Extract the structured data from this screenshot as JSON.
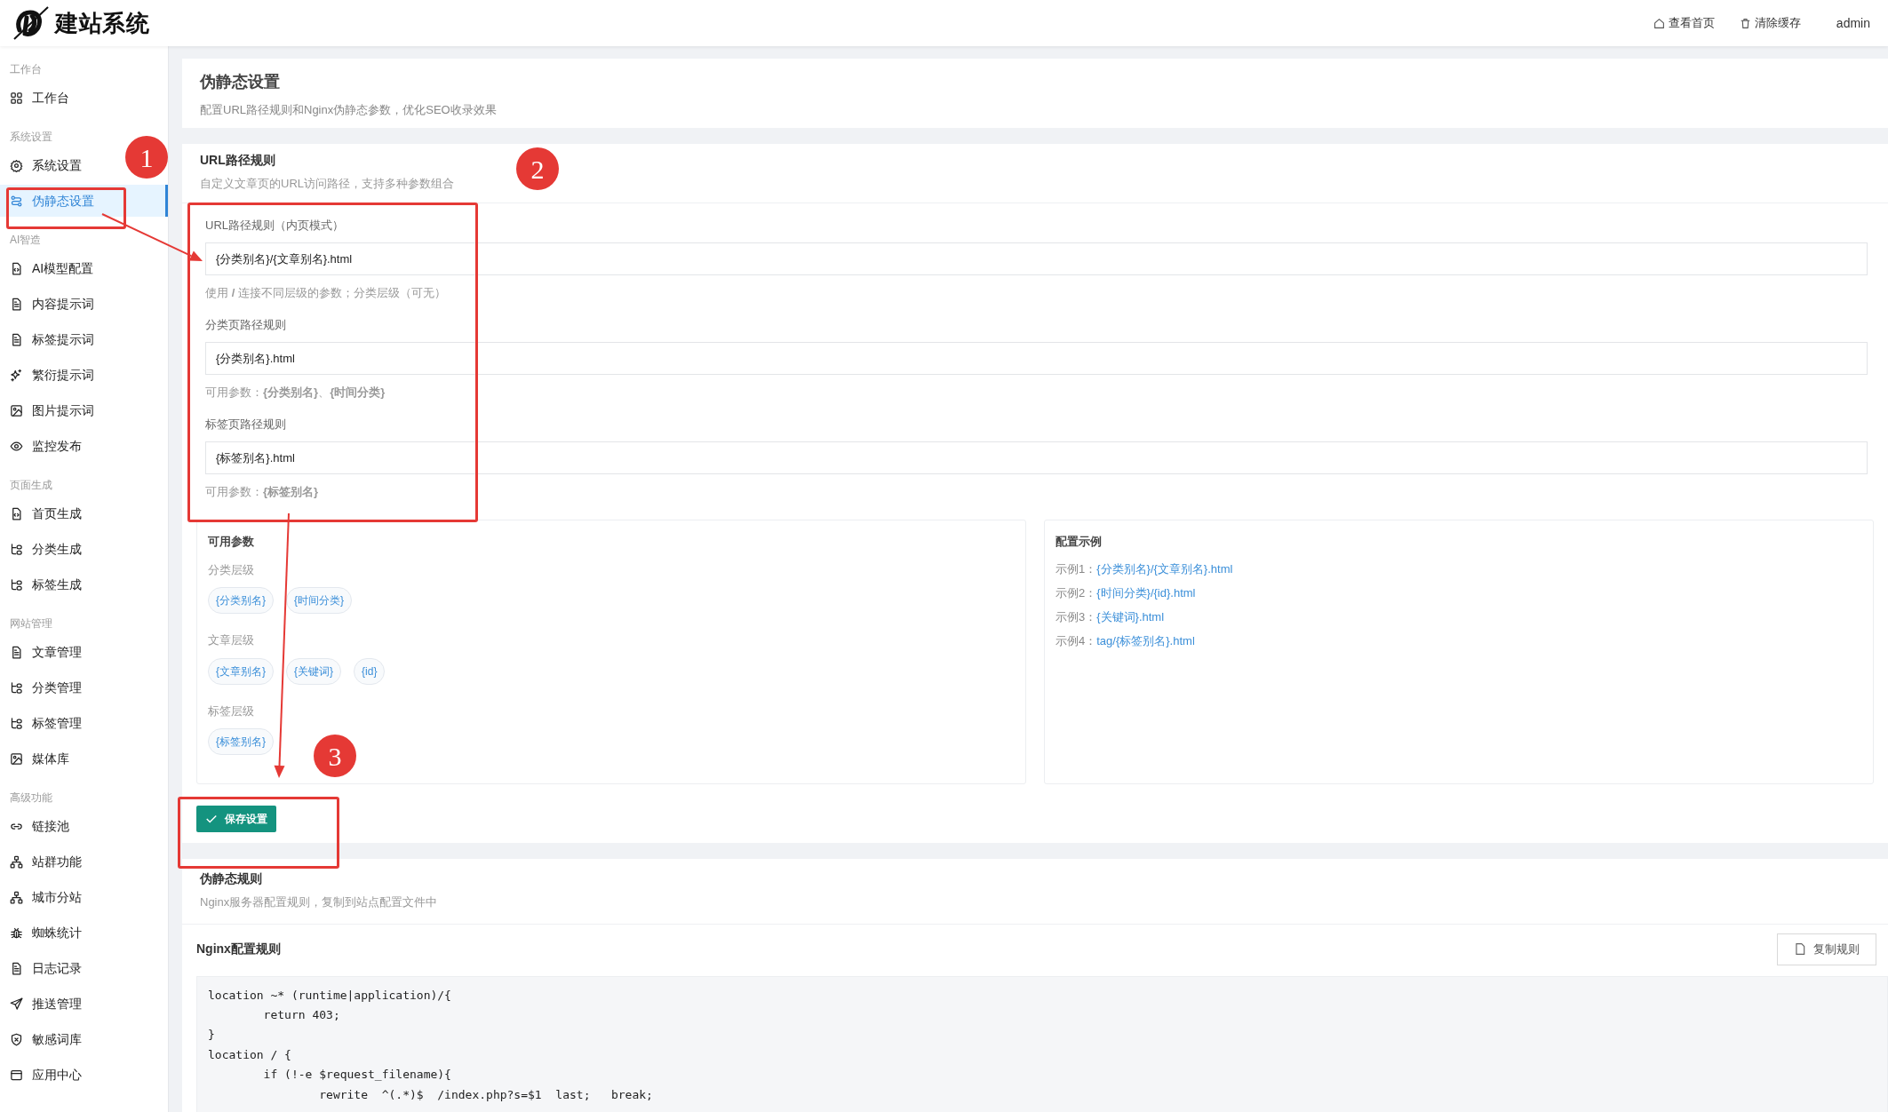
{
  "header": {
    "logo_text": "建站系统",
    "links": [
      {
        "kind": "home",
        "label": "查看首页"
      },
      {
        "kind": "trash",
        "label": "清除缓存"
      }
    ],
    "user": "admin"
  },
  "sidebar": {
    "groups": [
      {
        "title": "工作台",
        "items": [
          {
            "kind": "grid",
            "label": "工作台",
            "selected": false
          }
        ]
      },
      {
        "title": "系统设置",
        "items": [
          {
            "kind": "gear",
            "label": "系统设置",
            "selected": false
          },
          {
            "kind": "route",
            "label": "伪静态设置",
            "selected": true
          }
        ]
      },
      {
        "title": "AI智造",
        "items": [
          {
            "kind": "filecode",
            "label": "AI模型配置",
            "selected": false
          },
          {
            "kind": "file",
            "label": "内容提示词",
            "selected": false
          },
          {
            "kind": "file",
            "label": "标签提示词",
            "selected": false
          },
          {
            "kind": "sparkle",
            "label": "繁衍提示词",
            "selected": false
          },
          {
            "kind": "image",
            "label": "图片提示词",
            "selected": false
          },
          {
            "kind": "eye",
            "label": "监控发布",
            "selected": false
          }
        ]
      },
      {
        "title": "页面生成",
        "items": [
          {
            "kind": "filecode",
            "label": "首页生成",
            "selected": false
          },
          {
            "kind": "tree",
            "label": "分类生成",
            "selected": false
          },
          {
            "kind": "tree",
            "label": "标签生成",
            "selected": false
          }
        ]
      },
      {
        "title": "网站管理",
        "items": [
          {
            "kind": "file",
            "label": "文章管理",
            "selected": false
          },
          {
            "kind": "tree",
            "label": "分类管理",
            "selected": false
          },
          {
            "kind": "tree",
            "label": "标签管理",
            "selected": false
          },
          {
            "kind": "image",
            "label": "媒体库",
            "selected": false
          }
        ]
      },
      {
        "title": "高级功能",
        "items": [
          {
            "kind": "link",
            "label": "链接池",
            "selected": false
          },
          {
            "kind": "network",
            "label": "站群功能",
            "selected": false
          },
          {
            "kind": "network",
            "label": "城市分站",
            "selected": false
          },
          {
            "kind": "bug",
            "label": "蜘蛛统计",
            "selected": false
          },
          {
            "kind": "file",
            "label": "日志记录",
            "selected": false
          },
          {
            "kind": "send",
            "label": "推送管理",
            "selected": false
          },
          {
            "kind": "shield",
            "label": "敏感词库",
            "selected": false
          },
          {
            "kind": "window",
            "label": "应用中心",
            "selected": false
          }
        ]
      }
    ]
  },
  "page_header": {
    "title": "伪静态设置",
    "subtitle": "配置URL路径规则和Nginx伪静态参数，优化SEO收录效果"
  },
  "url_rules": {
    "title": "URL路径规则",
    "subtitle": "自定义文章页的URL访问路径，支持多种参数组合",
    "fields": [
      {
        "label": "URL路径规则（内页模式）",
        "value": "{分类别名}/{文章别名}.html",
        "hint": "使用 **/** 连接不同层级的参数；分类层级（可无）"
      },
      {
        "label": "分类页路径规则",
        "value": "{分类别名}.html",
        "hint": "可用参数：**{分类别名}**、**{时间分类}**"
      },
      {
        "label": "标签页路径规则",
        "value": "{标签别名}.html",
        "hint": "可用参数：**{标签别名}**"
      }
    ],
    "params": {
      "title": "可用参数",
      "groups": [
        {
          "title": "分类层级",
          "tags": [
            "{分类别名}",
            "{时间分类}"
          ]
        },
        {
          "title": "文章层级",
          "tags": [
            "{文章别名}",
            "{关键词}",
            "{id}"
          ]
        },
        {
          "title": "标签层级",
          "tags": [
            "{标签别名}"
          ]
        }
      ]
    },
    "examples": {
      "title": "配置示例",
      "items": [
        {
          "label": "示例1：",
          "value": "{分类别名}/{文章别名}.html"
        },
        {
          "label": "示例2：",
          "value": "{时间分类}/{id}.html"
        },
        {
          "label": "示例3：",
          "value": "{关键词}.html"
        },
        {
          "label": "示例4：",
          "value": "tag/{标签别名}.html"
        }
      ]
    },
    "save_button": "保存设置"
  },
  "rewrite": {
    "title": "伪静态规则",
    "subtitle": "Nginx服务器配置规则，复制到站点配置文件中",
    "code_title": "Nginx配置规则",
    "copy_button": "复制规则",
    "code_lines": [
      "location ~* (runtime|application)/{",
      "        return 403;",
      "}",
      "location / {",
      "        if (!-e $request_filename){",
      "                rewrite  ^(.*)$  /index.php?s=$1  last;   break;"
    ]
  },
  "annotations": [
    {
      "number": "1"
    },
    {
      "number": "2"
    },
    {
      "number": "3"
    }
  ]
}
